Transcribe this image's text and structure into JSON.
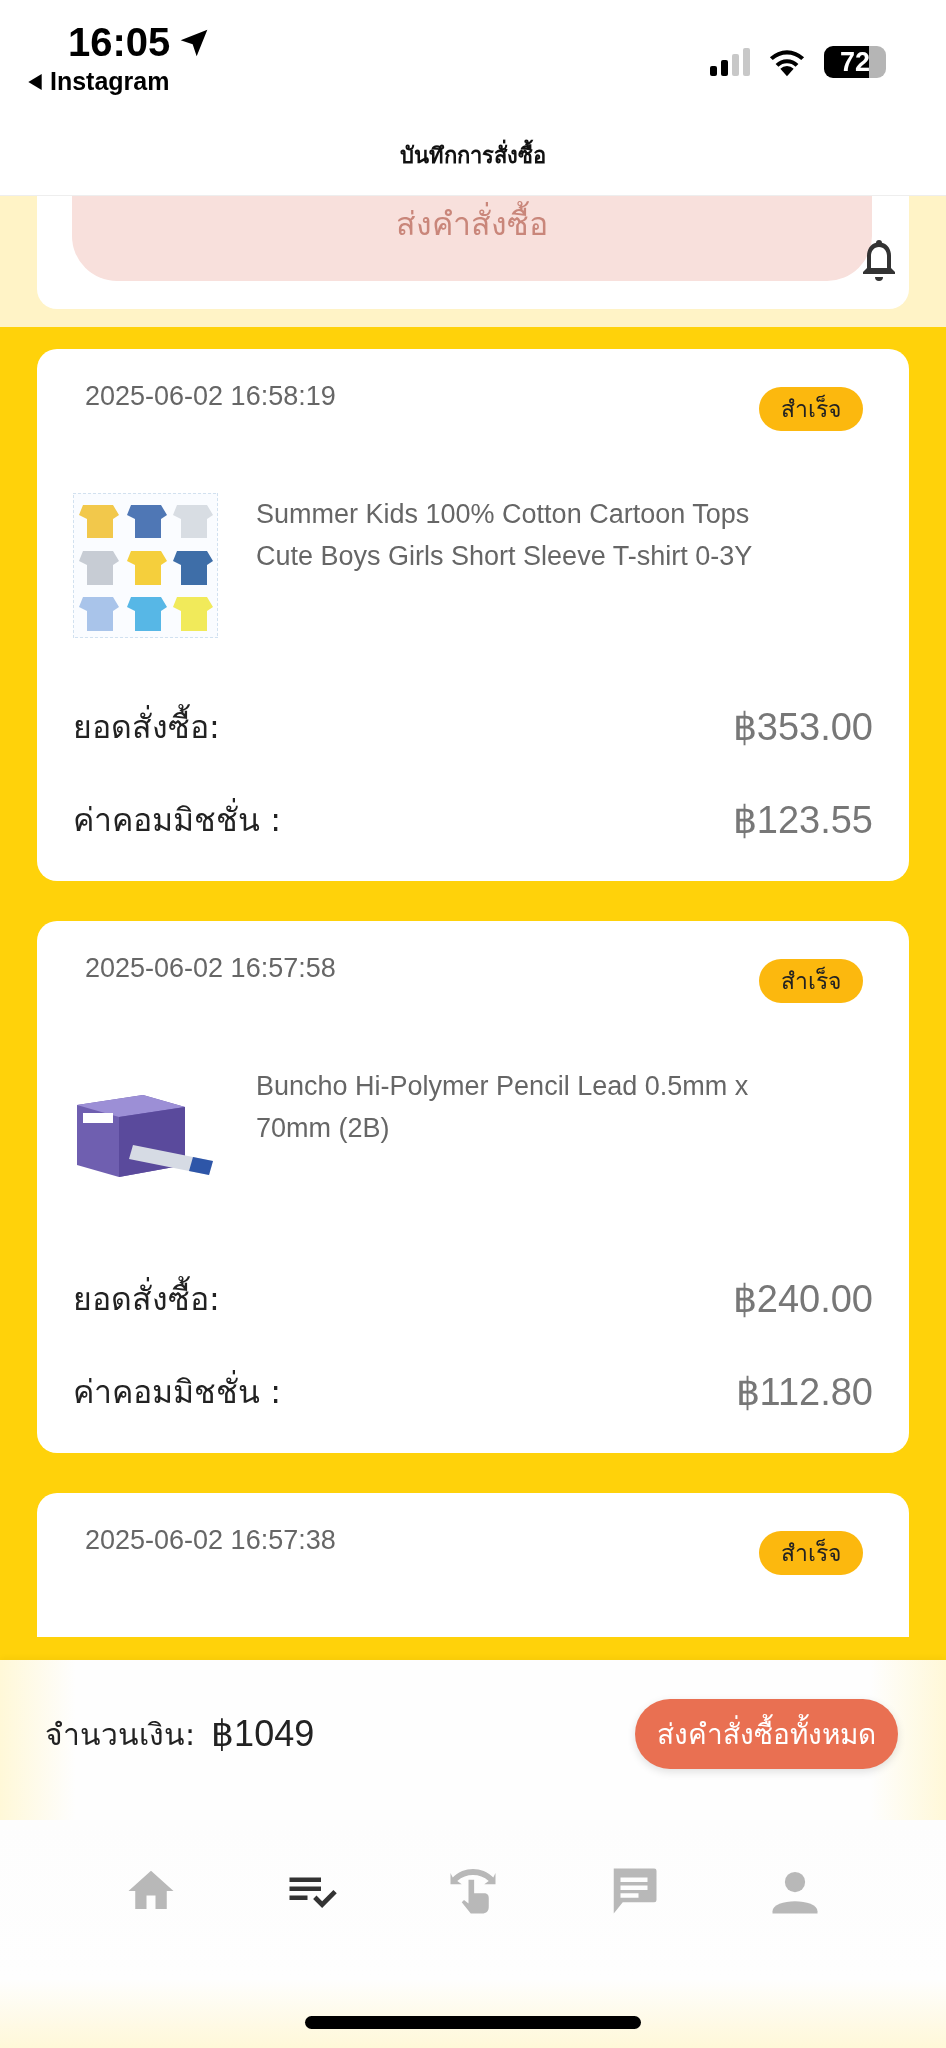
{
  "status_bar": {
    "time": "16:05",
    "back_label": "Instagram",
    "battery": "72"
  },
  "header": {
    "title": "บันทึกการสั่งซื้อ"
  },
  "submit_button": {
    "label": "ส่งคำสั่งซื้อ",
    "disabled": true
  },
  "orders": [
    {
      "date": "2025-06-02 16:58:19",
      "status": "สำเร็จ",
      "product": "Summer Kids 100% Cotton Cartoon Tops Cute Boys Girls Short Sleeve T-shirt 0-3Y",
      "amount_label": "ยอดสั่งซื้อ:",
      "amount": "฿353.00",
      "commission_label": "ค่าคอมมิชชั่น :",
      "commission": "฿123.55"
    },
    {
      "date": "2025-06-02 16:57:58",
      "status": "สำเร็จ",
      "product": "Buncho Hi-Polymer Pencil Lead 0.5mm x 70mm (2B)",
      "amount_label": "ยอดสั่งซื้อ:",
      "amount": "฿240.00",
      "commission_label": "ค่าคอมมิชชั่น :",
      "commission": "฿112.80"
    },
    {
      "date": "2025-06-02 16:57:38",
      "status": "สำเร็จ"
    }
  ],
  "summary": {
    "label": "จำนวนเงิน:",
    "total": "฿1049",
    "button": "ส่งคำสั่งซื้อทั้งหมด"
  },
  "nav": [
    {
      "kind": "home",
      "selected": false
    },
    {
      "kind": "orders",
      "selected": true
    },
    {
      "kind": "swipe",
      "selected": false
    },
    {
      "kind": "chat",
      "selected": false
    },
    {
      "kind": "profile",
      "selected": false
    }
  ]
}
